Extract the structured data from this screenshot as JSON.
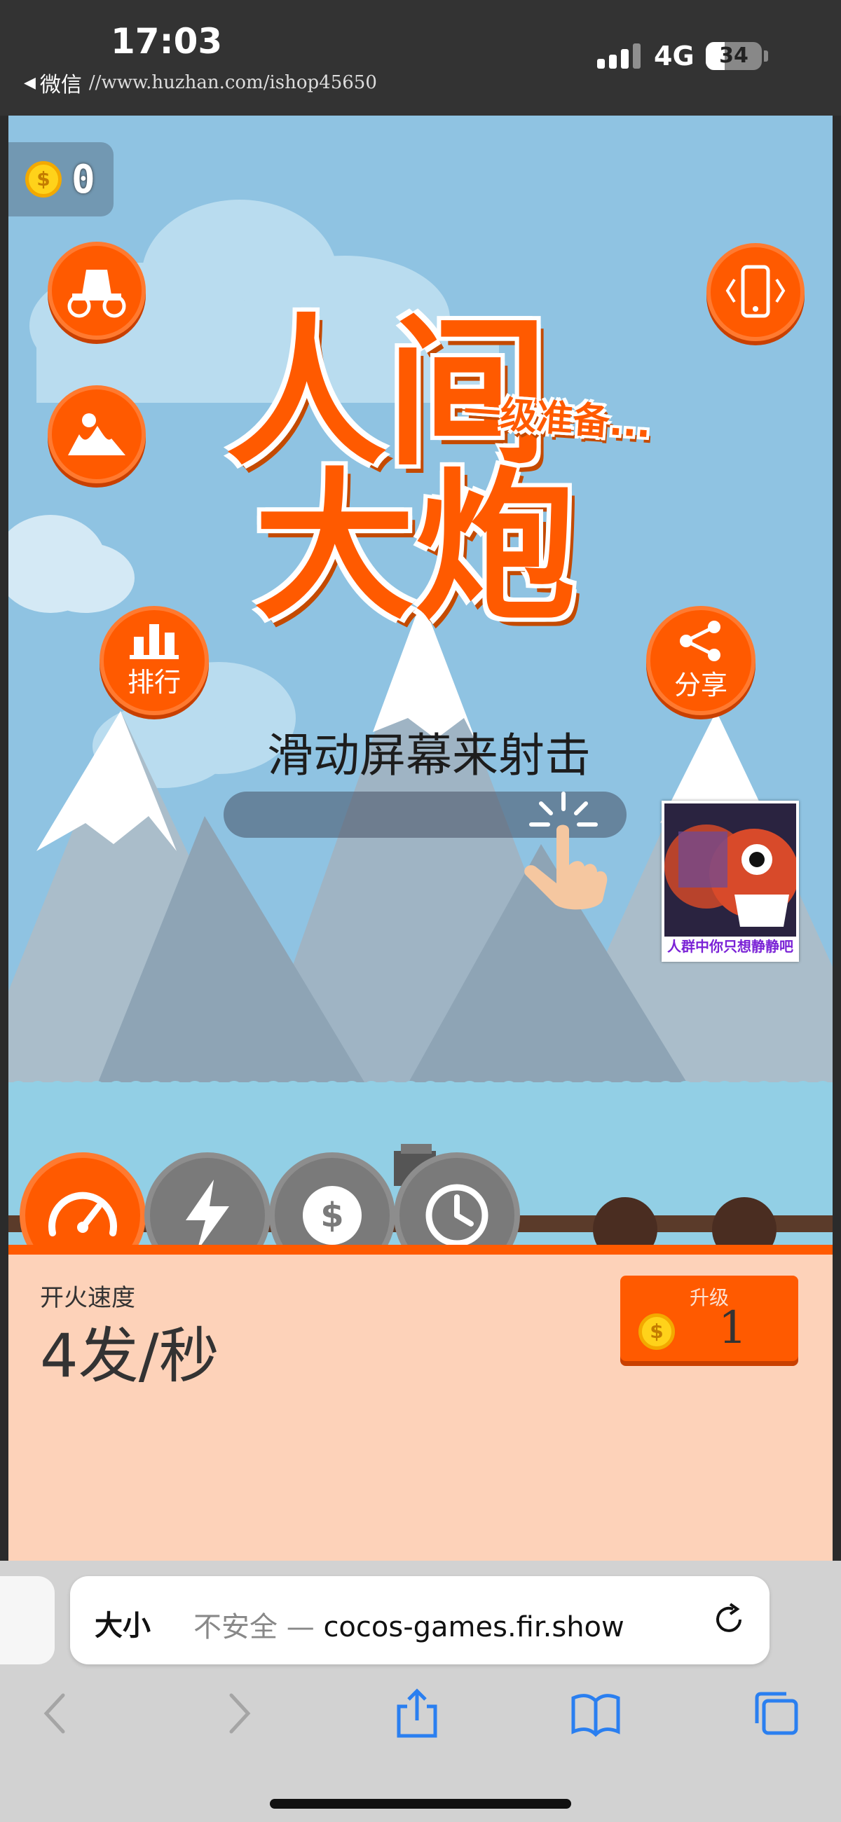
{
  "status_bar": {
    "time": "17:03",
    "back_app": "微信",
    "url": "//www.huzhan.com/ishop45650",
    "network": "4G",
    "battery": "34",
    "battery_level": 0.34
  },
  "game": {
    "coins": "0",
    "title_line1": "人间",
    "title_line2": "大炮",
    "subtitle": "一级准备...",
    "rank_label": "排行",
    "share_label": "分享",
    "instruction": "滑动屏幕来射击",
    "ad_text": "人群中你只想静静吧",
    "icons": {
      "cannon": "cannon-cart-icon",
      "landscape": "landscape-icon",
      "vibrate": "phone-vibrate-icon",
      "rank": "bar-chart-icon",
      "share": "share-icon",
      "hand": "hand-pointer-icon"
    },
    "upgrade_tabs": [
      "speedometer-icon",
      "lightning-icon",
      "dollar-icon",
      "clock-icon"
    ],
    "panel": {
      "label": "开火速度",
      "value": "4发/秒",
      "upgrade_label": "升级",
      "upgrade_cost": "1"
    },
    "colors": {
      "accent": "#ff5a00",
      "sky": "#8fc3e2",
      "panel": "#fdd2b9"
    }
  },
  "safari": {
    "text_size": "大小",
    "insecure": "不安全 — ",
    "domain": "cocos-games.fir.show",
    "icons": [
      "back-icon",
      "forward-icon",
      "share-icon",
      "bookmarks-icon",
      "tabs-icon"
    ]
  }
}
